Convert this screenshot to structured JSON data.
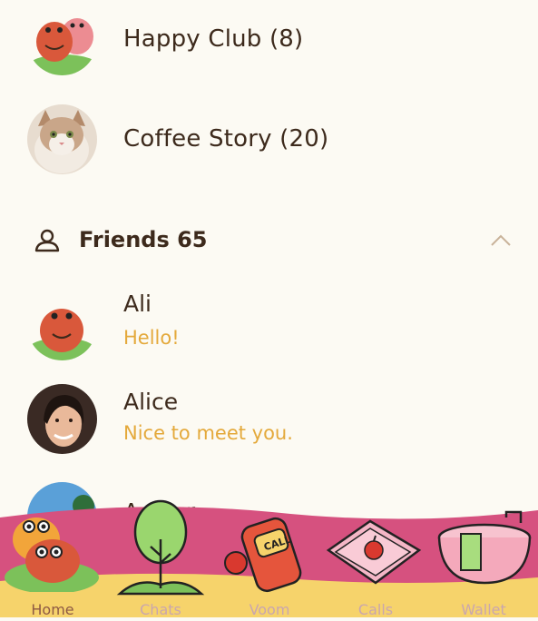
{
  "groups": [
    {
      "name": "Happy Club (8)",
      "avatar": "cartoon-character-avatar"
    },
    {
      "name": "Coffee Story (20)",
      "avatar": "cat-photo-avatar"
    }
  ],
  "friends_section": {
    "title": "Friends 65",
    "icon": "person-icon",
    "toggle_icon": "chevron-up-icon"
  },
  "friends": [
    {
      "name": "Ali",
      "status": "Hello!",
      "avatar": "cartoon-character-avatar"
    },
    {
      "name": "Alice",
      "status": "Nice to meet you.",
      "avatar": "woman-photo-avatar"
    },
    {
      "name": "Arthur",
      "status": "",
      "avatar": "landscape-photo-avatar"
    }
  ],
  "tabs": [
    {
      "label": "Home",
      "icon": "home-character-icon",
      "active": true
    },
    {
      "label": "Chats",
      "icon": "tree-icon",
      "active": false
    },
    {
      "label": "Voom",
      "icon": "call-phone-icon",
      "active": false
    },
    {
      "label": "Calls",
      "icon": "apple-box-icon",
      "active": false
    },
    {
      "label": "Wallet",
      "icon": "bathtub-icon",
      "active": false
    }
  ],
  "colors": {
    "background": "#fcfaf3",
    "text": "#3d2a1c",
    "status_text": "#e4a93b",
    "tabbar_pink": "#d6517f",
    "tabbar_yellow": "#f6d36b"
  }
}
